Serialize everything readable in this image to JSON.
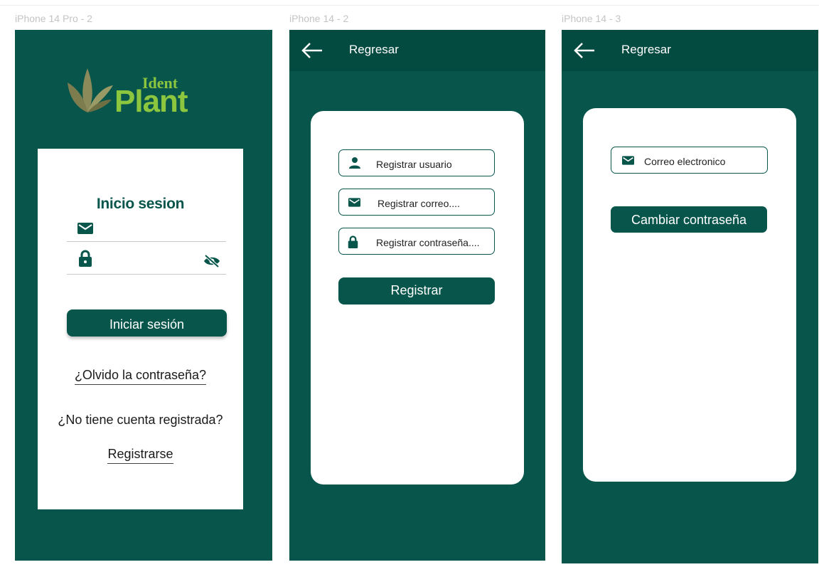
{
  "frames": [
    {
      "label": "iPhone 14 Pro - 2"
    },
    {
      "label": "iPhone 14 - 2"
    },
    {
      "label": "iPhone 14 - 3"
    }
  ],
  "login": {
    "logo_ident": "Ident",
    "logo_plant": "Plant",
    "title": "Inicio sesion",
    "login_button": "Iniciar sesión",
    "forgot_password": "¿Olvido la contraseña?",
    "no_account": "¿No tiene cuenta registrada?",
    "register_link": "Registrarse"
  },
  "register": {
    "header_title": "Regresar",
    "fields": [
      {
        "label": "Registrar usuario",
        "icon": "user-icon"
      },
      {
        "label": "Registrar correo....",
        "icon": "mail-icon"
      },
      {
        "label": "Registrar contraseña....",
        "icon": "lock-icon"
      }
    ],
    "submit_button": "Registrar"
  },
  "recover": {
    "header_title": "Regresar",
    "email_field": {
      "label": "Correo electronico",
      "icon": "mail-icon"
    },
    "change_button": "Cambiar contraseña"
  },
  "colors": {
    "frame_bg": "#07554b",
    "header_bg": "#034a40",
    "accent_green": "#8cc63f",
    "label_gray": "#c4c4c4"
  }
}
